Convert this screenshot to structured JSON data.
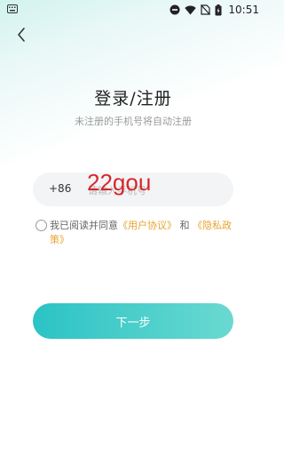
{
  "status_bar": {
    "left_icon": "keyboard-icon",
    "icons": [
      "dnd-icon",
      "wifi-icon",
      "no-sim-icon",
      "battery-charging-icon"
    ],
    "time": "10:51"
  },
  "header": {
    "back_icon": "chevron-left-icon",
    "title": "登录/注册",
    "subtitle": "未注册的手机号将自动注册"
  },
  "phone": {
    "country_code": "+86",
    "placeholder": "请输入手机号",
    "value": ""
  },
  "watermark": "22gou",
  "agreement": {
    "prefix": "我已阅读并同意",
    "user_agreement": "《用户协议》",
    "and": "和",
    "privacy_policy": "《隐私政策》"
  },
  "next_button": "下一步",
  "colors": {
    "accent_start": "#2bc3c5",
    "accent_end": "#6ad9d0",
    "link": "#e8a432",
    "watermark": "#d6282c"
  }
}
